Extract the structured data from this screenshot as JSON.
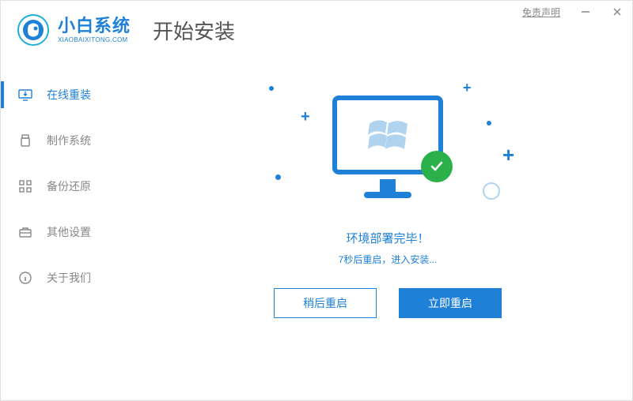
{
  "window": {
    "disclaimer": "免责声明"
  },
  "brand": {
    "name": "小白系统",
    "subtitle": "XIAOBAIXITONG.COM"
  },
  "page_title": "开始安装",
  "sidebar": {
    "items": [
      {
        "label": "在线重装"
      },
      {
        "label": "制作系统"
      },
      {
        "label": "备份还原"
      },
      {
        "label": "其他设置"
      },
      {
        "label": "关于我们"
      }
    ]
  },
  "status": {
    "title": "环境部署完毕！",
    "subtitle": "7秒后重启，进入安装..."
  },
  "buttons": {
    "later": "稍后重启",
    "now": "立即重启"
  }
}
